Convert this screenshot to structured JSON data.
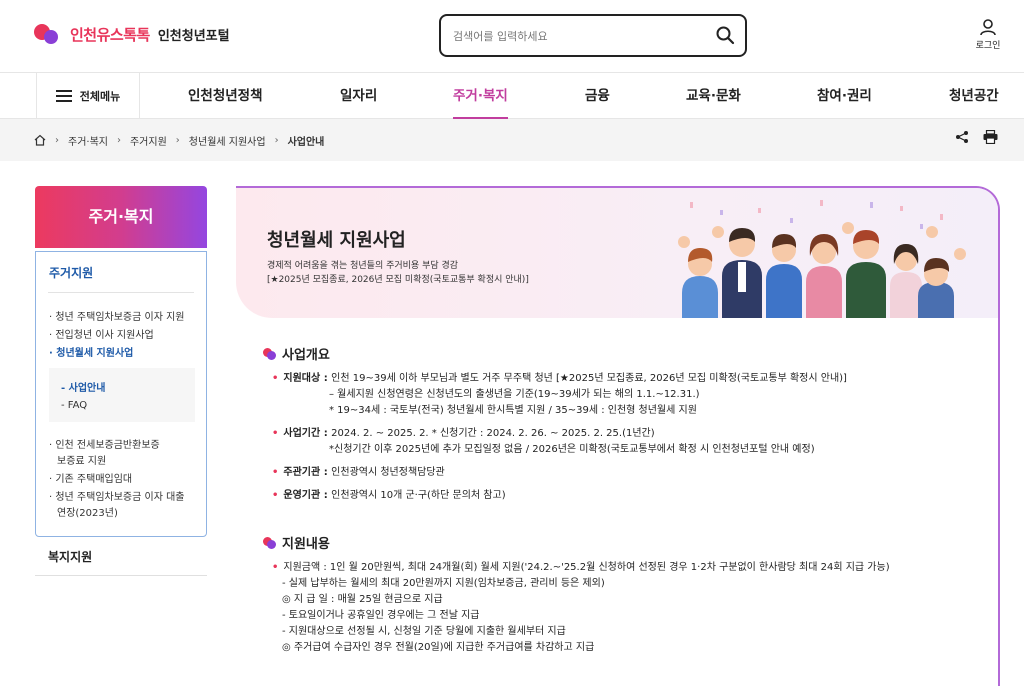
{
  "header": {
    "logo_brand": "인천유스톡톡",
    "logo_sub": "인천청년포털",
    "search_placeholder": "검색어를 입력하세요",
    "login_label": "로그인"
  },
  "gnb": {
    "all_menu": "전체메뉴",
    "items": [
      "인천청년정책",
      "일자리",
      "주거·복지",
      "금융",
      "교육·문화",
      "참여·권리",
      "청년공간"
    ],
    "active_index": 2
  },
  "breadcrumb": [
    "주거·복지",
    "주거지원",
    "청년월세 지원사업",
    "사업안내"
  ],
  "sidebar": {
    "title": "주거·복지",
    "group": "주거지원",
    "links": [
      "· 청년 주택임차보증금 이자 지원",
      "· 전입청년 이사 지원사업",
      "· 청년월세 지원사업"
    ],
    "sub": [
      "- 사업안내",
      "- FAQ"
    ],
    "links2": [
      "· 인천 전세보증금반환보증",
      "보증료 지원",
      "· 기존 주택매입임대",
      "· 청년 주택임차보증금 이자 대출",
      "연장(2023년)"
    ],
    "welfare": "복지지원"
  },
  "hero": {
    "title": "청년월세 지원사업",
    "desc1": "경제적 어려움을 겪는 청년들의 주거비용 부담 경감",
    "desc2": "[★2025년 모집종료, 2026년 모집 미확정(국토교통부 확정시 안내)]"
  },
  "overview": {
    "title": "사업개요",
    "target_label": "지원대상 : ",
    "target": "인천 19~39세 이하 부모님과 별도 거주 무주택 청년 [★2025년 모집종료, 2026년 모집 미확정(국토교통부 확정시 안내)]",
    "target_l2": "– 월세지원 신청연령은 신청년도의 출생년을 기준(19~39세가 되는 해의 1.1.~12.31.)",
    "target_l3": "* 19~34세 : 국토부(전국) 청년월세 한시특별 지원 / 35~39세 : 인천형 청년월세 지원",
    "period_label": "사업기간 : ",
    "period": "2024. 2. ~ 2025. 2. * 신청기간 : 2024. 2. 26. ~ 2025. 2. 25.(1년간)",
    "period_l2": "*신청기간 이후 2025년에 추가 모집일정 없음 / 2026년은 미확정(국토교통부에서 확정 시 인천청년포털 안내 예정)",
    "org_label": "주관기관 : ",
    "org": "인천광역시 청년정책담당관",
    "op_label": "운영기관 : ",
    "op": "인천광역시 10개 군·구(하단 문의처 참고)"
  },
  "support": {
    "title": "지원내용",
    "amount": "지원금액 : 1인 월 20만원씩, 최대 24개월(회) 월세 지원('24.2.~'25.2월 신청하여 선정된 경우 1·2차 구분없이 한사람당 최대 24회 지급 가능)",
    "l1": "- 실제 납부하는 월세의 최대 20만원까지 지원(임차보증금, 관리비 등은 제외)",
    "l2": "◎ 지 급 일 : 매월 25일 현금으로 지급",
    "l3": "- 토요일이거나 공휴일인 경우에는 그 전날 지급",
    "l4": "- 지원대상으로 선정될 시, 신청일 기준 당월에 지출한 월세부터 지급",
    "l5": "◎ 주거급여 수급자인 경우 전월(20일)에 지급한 주거급여를 차감하고 지급"
  },
  "colors": {
    "brand": "#e8355a",
    "accent": "#c13d9e",
    "purple": "#9446e0",
    "link_blue": "#1e5aa8"
  },
  "icons": [
    "home-icon",
    "share-icon",
    "print-icon",
    "search-icon",
    "user-icon",
    "hamburger-icon"
  ]
}
